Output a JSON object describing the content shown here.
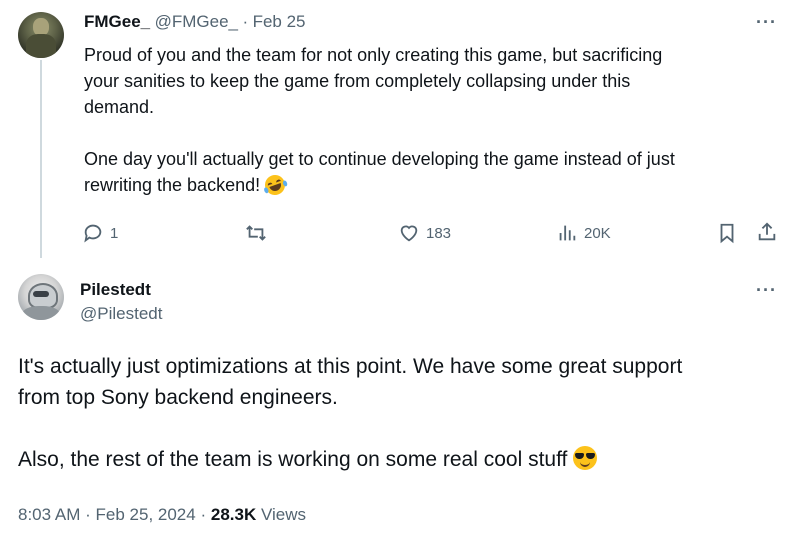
{
  "reply": {
    "display_name": "FMGee_",
    "handle": "@FMGee_",
    "separator": "·",
    "date": "Feb 25",
    "text_lines": [
      "Proud of you and the team for not only creating this game, but sacrificing",
      "your sanities to keep the game from completely collapsing under this",
      "demand.",
      "",
      "One day you'll actually get to continue developing the game instead of just",
      "rewriting the backend!"
    ],
    "emoji": "rolling-on-the-floor-laughing",
    "more": "···",
    "actions": {
      "replies": "1",
      "reposts": "",
      "likes": "183",
      "views": "20K"
    }
  },
  "main": {
    "display_name": "Pilestedt",
    "handle": "@Pilestedt",
    "more": "···",
    "text_lines": [
      "It's actually just optimizations at this point. We have some great support",
      "from top Sony backend engineers.",
      "",
      "Also, the rest of the team is working on some real cool stuff"
    ],
    "emoji": "smiling-face-with-sunglasses",
    "footer": {
      "time": "8:03 AM",
      "sep1": "·",
      "date": "Feb 25, 2024",
      "sep2": "·",
      "views_count": "28.3K",
      "views_label": "Views"
    }
  },
  "colors": {
    "text": "#0f1419",
    "secondary": "#536471",
    "thread_line": "#cfd9de"
  },
  "icons": [
    "reply-icon",
    "repost-icon",
    "like-icon",
    "views-icon",
    "bookmark-icon",
    "share-icon",
    "more-icon"
  ]
}
